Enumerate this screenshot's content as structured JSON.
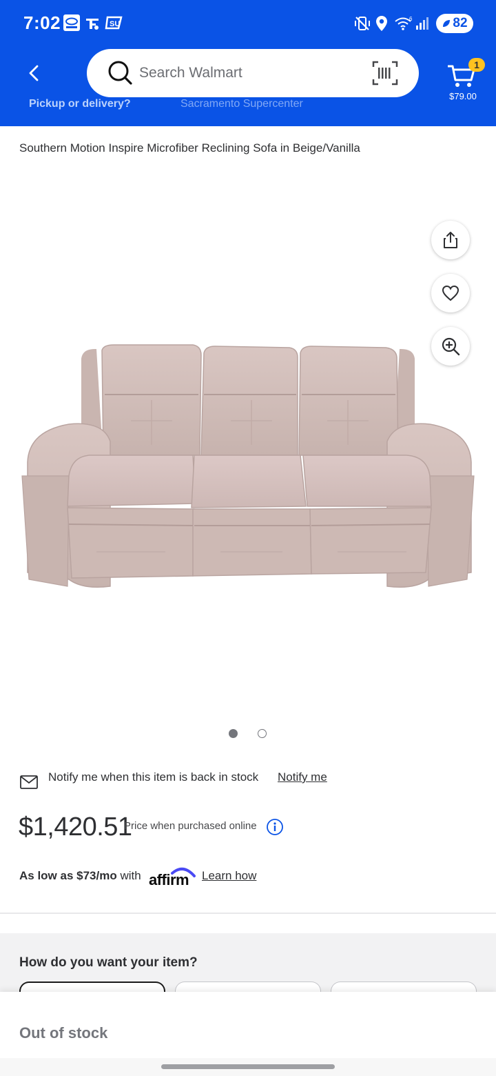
{
  "status_bar": {
    "time": "7:02",
    "battery": "82"
  },
  "header": {
    "search_placeholder": "Search Walmart",
    "cart_count": "1",
    "cart_total": "$79.00",
    "sub_strip_left": "Pickup or delivery?",
    "sub_strip_right": "Sacramento Supercenter"
  },
  "product": {
    "title": "Southern Motion Inspire Microfiber Reclining Sofa in Beige/Vanilla",
    "image_alt": "beige microfiber reclining sofa"
  },
  "gallery": {
    "count": 2,
    "active_index": 0
  },
  "notify": {
    "text": "Notify me when this item is back in stock",
    "link": "Notify me"
  },
  "pricing": {
    "price": "$1,420.51",
    "note": "Price when purchased online"
  },
  "financing": {
    "prefix": "As low as $73/mo",
    "with": " with",
    "brand": "affirm",
    "link": "Learn how"
  },
  "fulfillment": {
    "title": "How do you want your item?"
  },
  "bottom": {
    "status": "Out of stock"
  },
  "colors": {
    "brand_blue": "#0a53e6",
    "badge_yellow": "#ffc220",
    "affirm_purple": "#4a4af4"
  }
}
